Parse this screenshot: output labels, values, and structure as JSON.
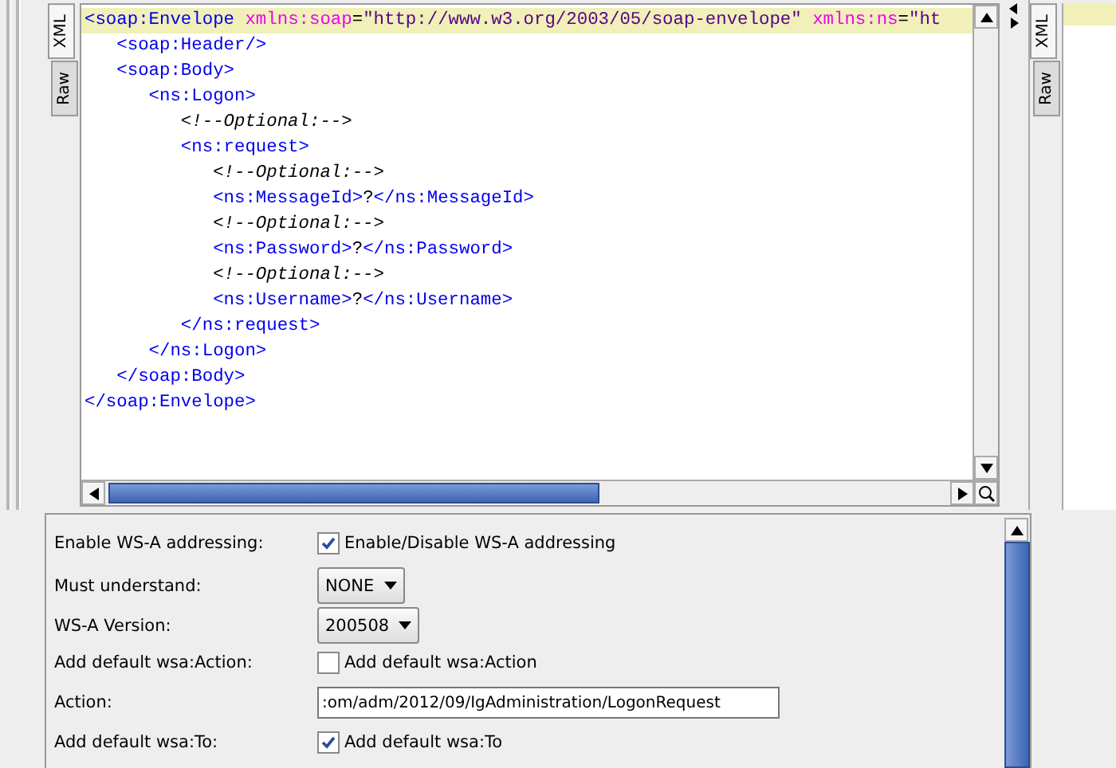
{
  "left_tabs": [
    {
      "label": "XML",
      "selected": true
    },
    {
      "label": "Raw",
      "selected": false
    }
  ],
  "editor": {
    "lines": [
      {
        "highlighted": true,
        "segments": [
          {
            "kind": "tag",
            "text": "<soap:Envelope "
          },
          {
            "kind": "attr",
            "text": "xmlns:soap"
          },
          {
            "kind": "plain",
            "text": "="
          },
          {
            "kind": "value",
            "text": "\"http://www.w3.org/2003/05/soap-envelope\" "
          },
          {
            "kind": "attr",
            "text": "xmlns:ns"
          },
          {
            "kind": "plain",
            "text": "="
          },
          {
            "kind": "value",
            "text": "\"ht"
          }
        ]
      },
      {
        "highlighted": false,
        "segments": [
          {
            "kind": "tag",
            "text": "   <soap:Header/>"
          }
        ]
      },
      {
        "highlighted": false,
        "segments": [
          {
            "kind": "tag",
            "text": "   <soap:Body>"
          }
        ]
      },
      {
        "highlighted": false,
        "segments": [
          {
            "kind": "tag",
            "text": "      <ns:Logon>"
          }
        ]
      },
      {
        "highlighted": false,
        "segments": [
          {
            "kind": "comment",
            "text": "         <!--Optional:-->"
          }
        ]
      },
      {
        "highlighted": false,
        "segments": [
          {
            "kind": "tag",
            "text": "         <ns:request>"
          }
        ]
      },
      {
        "highlighted": false,
        "segments": [
          {
            "kind": "comment",
            "text": "            <!--Optional:-->"
          }
        ]
      },
      {
        "highlighted": false,
        "segments": [
          {
            "kind": "tag",
            "text": "            <ns:MessageId>"
          },
          {
            "kind": "plain",
            "text": "?"
          },
          {
            "kind": "tag",
            "text": "</ns:MessageId>"
          }
        ]
      },
      {
        "highlighted": false,
        "segments": [
          {
            "kind": "comment",
            "text": "            <!--Optional:-->"
          }
        ]
      },
      {
        "highlighted": false,
        "segments": [
          {
            "kind": "tag",
            "text": "            <ns:Password>"
          },
          {
            "kind": "plain",
            "text": "?"
          },
          {
            "kind": "tag",
            "text": "</ns:Password>"
          }
        ]
      },
      {
        "highlighted": false,
        "segments": [
          {
            "kind": "comment",
            "text": "            <!--Optional:-->"
          }
        ]
      },
      {
        "highlighted": false,
        "segments": [
          {
            "kind": "tag",
            "text": "            <ns:Username>"
          },
          {
            "kind": "plain",
            "text": "?"
          },
          {
            "kind": "tag",
            "text": "</ns:Username>"
          }
        ]
      },
      {
        "highlighted": false,
        "segments": [
          {
            "kind": "tag",
            "text": "         </ns:request>"
          }
        ]
      },
      {
        "highlighted": false,
        "segments": [
          {
            "kind": "tag",
            "text": "      </ns:Logon>"
          }
        ]
      },
      {
        "highlighted": false,
        "segments": [
          {
            "kind": "tag",
            "text": "   </soap:Body>"
          }
        ]
      },
      {
        "highlighted": false,
        "segments": [
          {
            "kind": "tag",
            "text": "</soap:Envelope>"
          }
        ]
      }
    ]
  },
  "right_tabs": [
    {
      "label": "XML",
      "selected": true
    },
    {
      "label": "Raw",
      "selected": false
    }
  ],
  "ws_addressing": {
    "rows": [
      {
        "label": "Enable WS-A addressing:",
        "kind": "checkbox",
        "checked": true,
        "caption": "Enable/Disable WS-A addressing"
      },
      {
        "label": "Must understand:",
        "kind": "select",
        "value": "NONE"
      },
      {
        "label": "WS-A Version:",
        "kind": "select",
        "value": "200508"
      },
      {
        "label": "Add default wsa:Action:",
        "kind": "checkbox",
        "checked": false,
        "caption": "Add default wsa:Action"
      },
      {
        "label": "Action:",
        "kind": "input",
        "value": ":om/adm/2012/09/IgAdministration/LogonRequest"
      },
      {
        "label": "Add default wsa:To:",
        "kind": "checkbox",
        "checked": true,
        "caption": "Add default wsa:To"
      }
    ]
  }
}
